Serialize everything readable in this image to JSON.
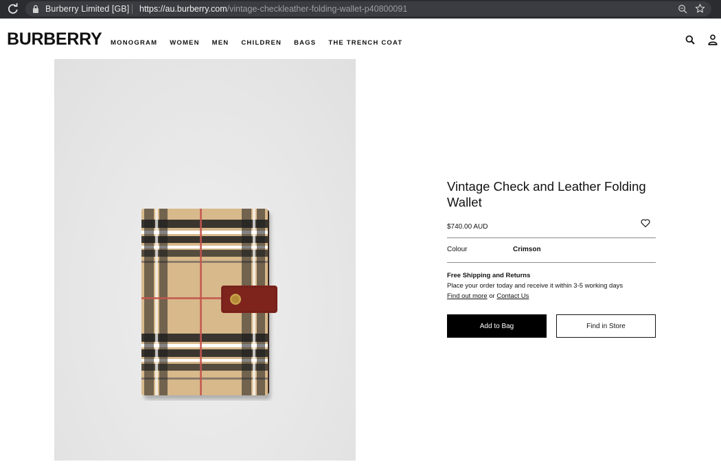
{
  "browser": {
    "site_name": "Burberry Limited [GB]",
    "url_prefix": "https://",
    "url_host": "au.burberry.com",
    "url_path": "/vintage-checkleather-folding-wallet-p40800091"
  },
  "header": {
    "logo": "BURBERRY",
    "nav": [
      "MONOGRAM",
      "WOMEN",
      "MEN",
      "CHILDREN",
      "BAGS",
      "THE TRENCH COAT"
    ],
    "icons": [
      "search-icon",
      "account-icon"
    ]
  },
  "product": {
    "title": "Vintage Check and Leather Folding Wallet",
    "price": "$740.00 AUD",
    "colour_label": "Colour",
    "colour_value": "Crimson",
    "shipping_title": "Free Shipping and Returns",
    "shipping_text": "Place your order today and receive it within 3-5 working days",
    "find_out_more": "Find out more",
    "or_text": "or",
    "contact_us": "Contact Us",
    "add_to_bag": "Add to Bag",
    "find_in_store": "Find in Store"
  },
  "colors": {
    "check_beige": "#d9b98c",
    "strap_crimson": "#8a2a22",
    "button_black": "#000000"
  }
}
